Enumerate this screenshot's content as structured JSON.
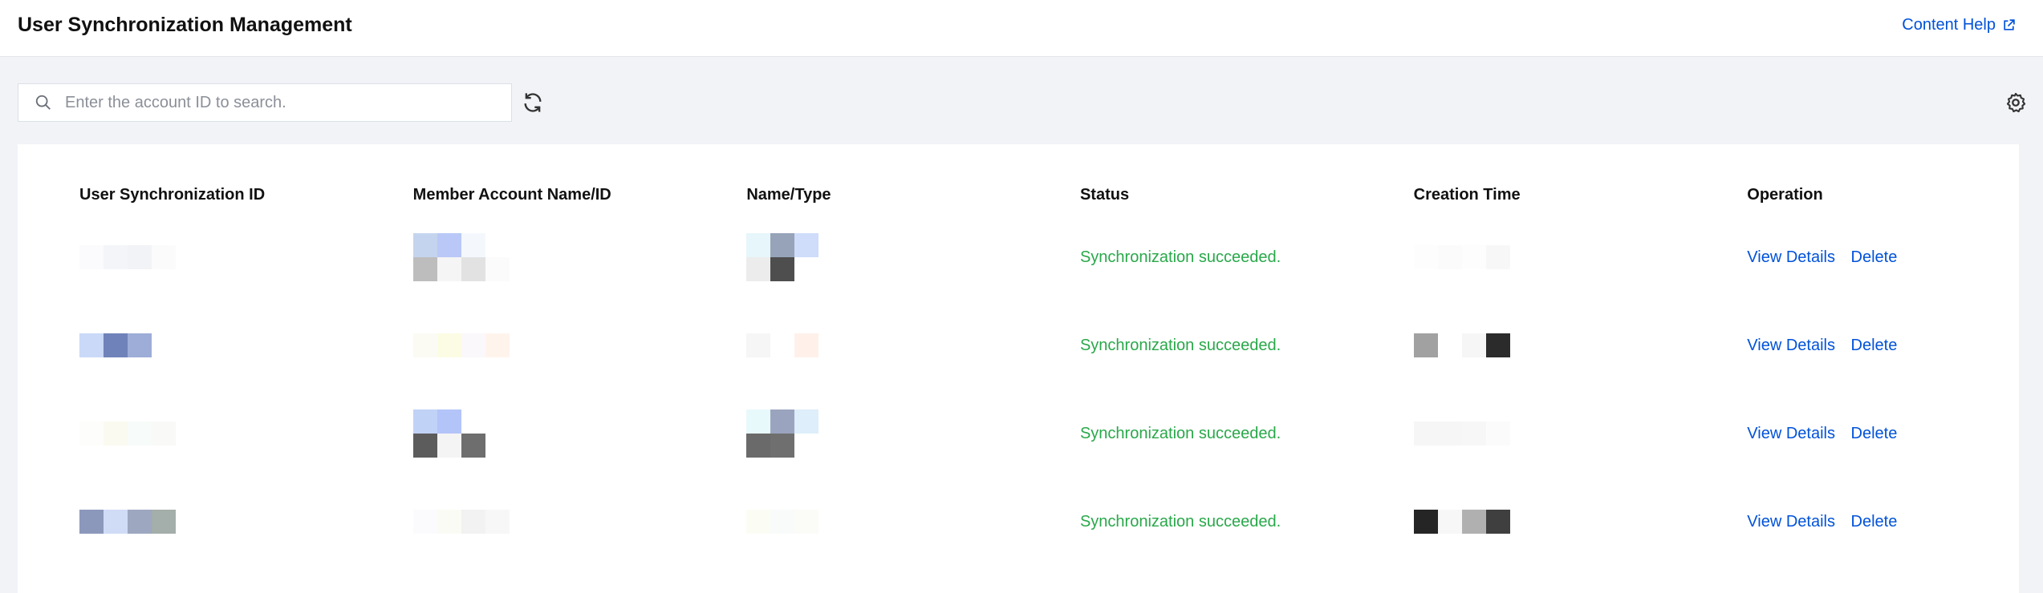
{
  "header": {
    "title": "User Synchronization Management",
    "help_label": "Content Help"
  },
  "toolbar": {
    "search_placeholder": "Enter the account ID to search.",
    "search_value": ""
  },
  "table": {
    "columns": [
      "User Synchronization ID",
      "Member Account Name/ID",
      "Name/Type",
      "Status",
      "Creation Time",
      "Operation"
    ],
    "rows": [
      {
        "status": "Synchronization succeeded.",
        "op_view": "View Details",
        "op_delete": "Delete"
      },
      {
        "status": "Synchronization succeeded.",
        "op_view": "View Details",
        "op_delete": "Delete"
      },
      {
        "status": "Synchronization succeeded.",
        "op_view": "View Details",
        "op_delete": "Delete"
      },
      {
        "status": "Synchronization succeeded.",
        "op_view": "View Details",
        "op_delete": "Delete"
      }
    ]
  },
  "icons": {
    "search": "search-icon",
    "refresh": "refresh-icon",
    "settings": "gear-icon",
    "external": "external-link-icon"
  },
  "colors": {
    "accent": "#0052d9",
    "success": "#29a84a",
    "background": "#f2f3f7"
  }
}
